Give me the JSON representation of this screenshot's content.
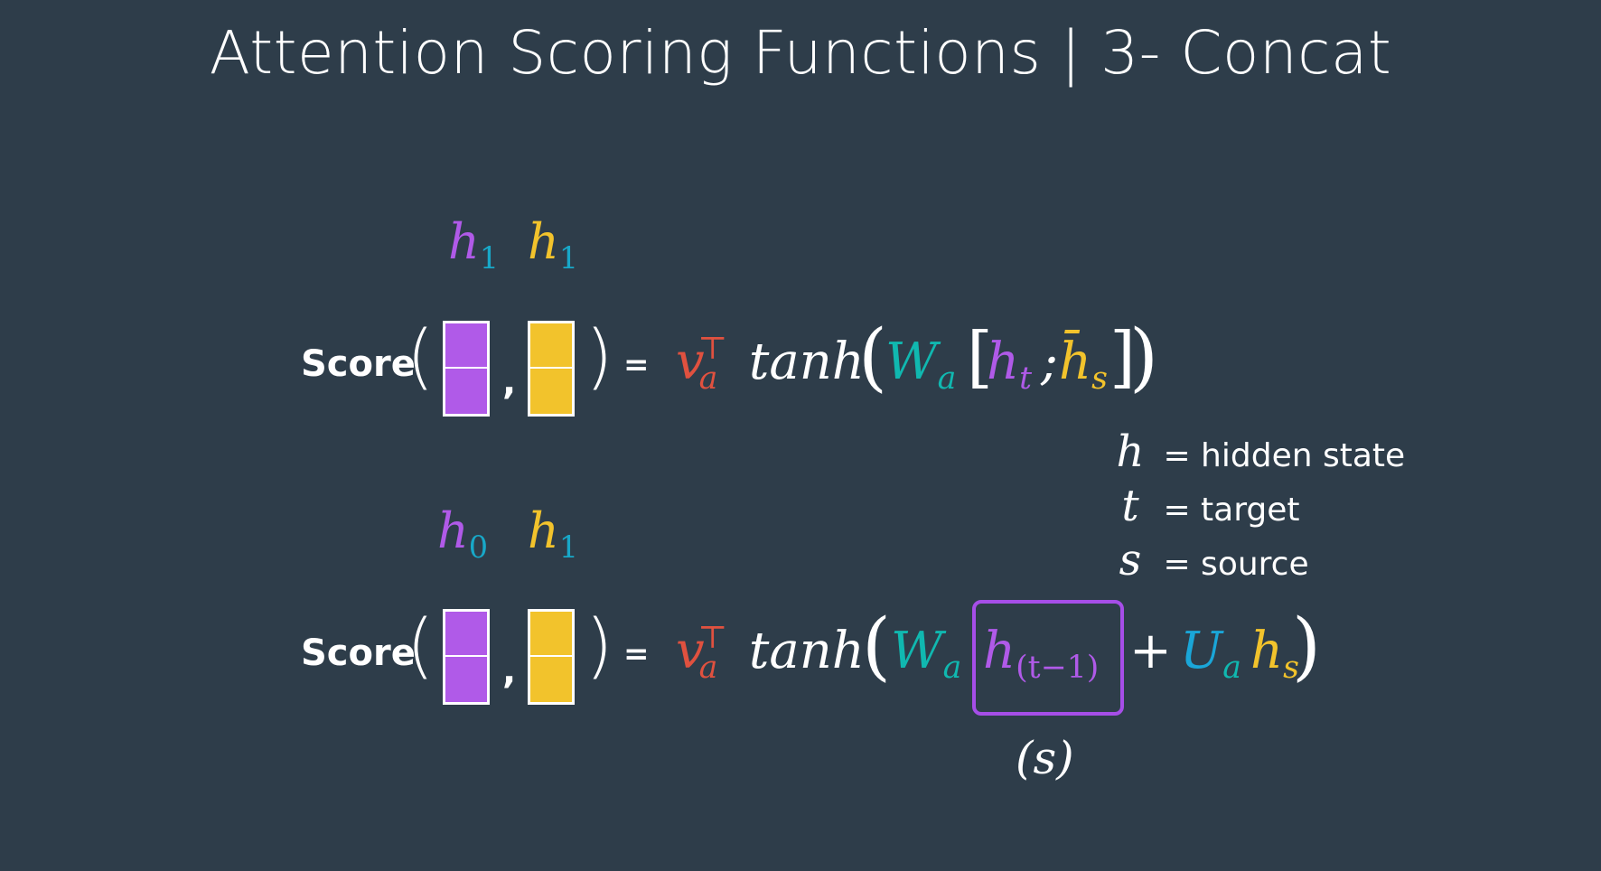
{
  "title": "Attention Scoring Functions | 3- Concat",
  "colors": {
    "background": "#2e3d4a",
    "purple": "#b05ae8",
    "yellow": "#f2c32c",
    "teal": "#10b8b0",
    "red": "#e0513f",
    "box": "#a64ee8"
  },
  "row1": {
    "label_left": {
      "h": "h",
      "sub": "1"
    },
    "label_right": {
      "h": "h",
      "sub": "1"
    },
    "score": "Score",
    "paren_open": "(",
    "comma": ",",
    "paren_close": ")",
    "equals": "=",
    "v": "v",
    "v_sub": "a",
    "v_sup": "⊤",
    "tanh": "tanh",
    "W": "W",
    "W_sub": "a",
    "ht": "h",
    "ht_sub": "t",
    "semicolon": ";",
    "hs": "h̄",
    "hs_sub": "s"
  },
  "row2": {
    "label_left": {
      "h": "h",
      "sub": "0"
    },
    "label_right": {
      "h": "h",
      "sub": "1"
    },
    "score": "Score",
    "paren_open": "(",
    "comma": ",",
    "paren_close": ")",
    "equals": "=",
    "v": "v",
    "v_sub": "a",
    "v_sup": "⊤",
    "tanh": "tanh",
    "W": "W",
    "W_sub": "a",
    "h": "h",
    "h_sub": "(t−1)",
    "plus": "+",
    "U": "U",
    "U_sub": "a",
    "hs": "h",
    "hs_sub": "s",
    "below_box": "(s)"
  },
  "legend": [
    {
      "symbol": "h",
      "text": "= hidden state"
    },
    {
      "symbol": "t",
      "text": "= target"
    },
    {
      "symbol": "s",
      "text": "= source"
    }
  ]
}
